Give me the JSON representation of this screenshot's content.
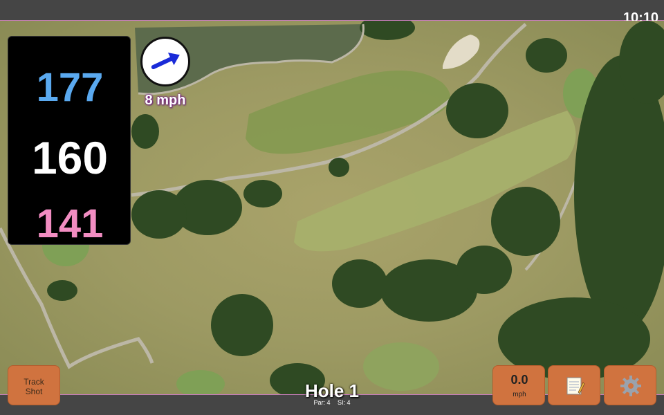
{
  "status_bar": {
    "time": "10:10"
  },
  "distances": {
    "back": "177",
    "middle": "160",
    "front": "141"
  },
  "wind": {
    "speed_label": "8 mph",
    "direction_icon": "arrow-up-right-icon",
    "direction_degrees": 65
  },
  "buttons": {
    "track_shot_line1": "Track",
    "track_shot_line2": "Shot",
    "speed_value": "0.0",
    "speed_unit": "mph",
    "notes_icon": "notepad-icon",
    "settings_icon": "gear-icon"
  },
  "hole": {
    "title": "Hole 1",
    "par": "Par: 4",
    "si": "SI: 4"
  },
  "colors": {
    "back": "#5aa9ef",
    "middle": "#ffffff",
    "front": "#f28dc2",
    "button": "#d0733f",
    "accent_line": "#c77dba"
  }
}
